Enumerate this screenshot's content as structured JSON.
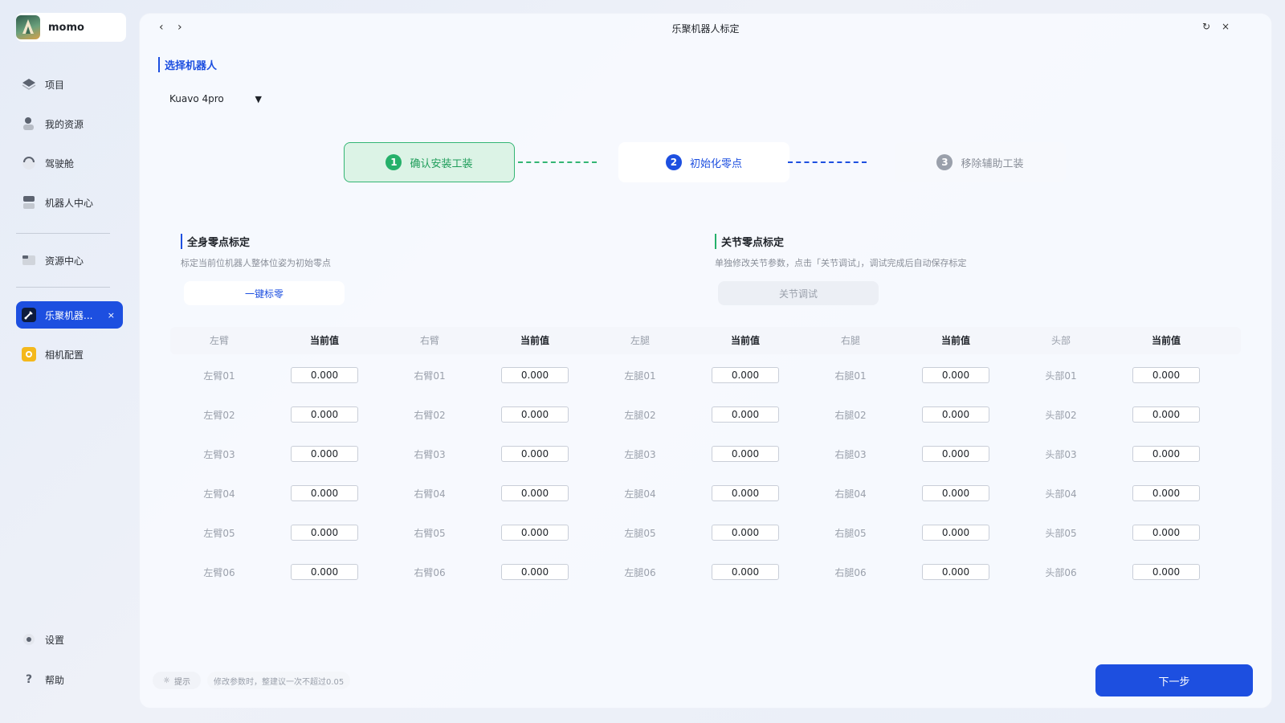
{
  "app": {
    "name": "momo"
  },
  "sidebar": {
    "items": [
      {
        "label": "项目",
        "icon": "layers-icon"
      },
      {
        "label": "我的资源",
        "icon": "user-resource-icon"
      },
      {
        "label": "驾驶舱",
        "icon": "cockpit-icon"
      },
      {
        "label": "机器人中心",
        "icon": "robot-center-icon"
      },
      {
        "label": "资源中心",
        "icon": "folder-icon"
      },
      {
        "label": "乐聚机器...",
        "icon": "robot-tool-icon",
        "active": true,
        "close": "×"
      },
      {
        "label": "相机配置",
        "icon": "camera-icon"
      }
    ],
    "bottom": [
      {
        "label": "设置",
        "icon": "settings-dot-icon"
      },
      {
        "label": "帮助",
        "icon": "help-icon",
        "glyph": "?"
      }
    ]
  },
  "window": {
    "title": "乐聚机器人标定",
    "back": "‹",
    "forward": "›",
    "refresh": "↻",
    "close": "×"
  },
  "robot_select": {
    "title": "选择机器人",
    "value": "Kuavo 4pro",
    "caret": "▼"
  },
  "steps": [
    {
      "num": "1",
      "label": "确认安装工装",
      "state": "done"
    },
    {
      "num": "2",
      "label": "初始化零点",
      "state": "current"
    },
    {
      "num": "3",
      "label": "移除辅助工装",
      "state": "pending"
    }
  ],
  "whole_body": {
    "title": "全身零点标定",
    "desc": "标定当前位机器人整体位姿为初始零点",
    "button": "一键标零"
  },
  "joint": {
    "title": "关节零点标定",
    "desc": "单独修改关节参数，点击「关节调试」，调试完成后自动保存标定",
    "button": "关节调试"
  },
  "table": {
    "headers": [
      "左臂",
      "当前值",
      "右臂",
      "当前值",
      "左腿",
      "当前值",
      "右腿",
      "当前值",
      "头部",
      "当前值"
    ],
    "rows": [
      [
        "左臂01",
        "0.000",
        "右臂01",
        "0.000",
        "左腿01",
        "0.000",
        "右腿01",
        "0.000",
        "头部01",
        "0.000"
      ],
      [
        "左臂02",
        "0.000",
        "右臂02",
        "0.000",
        "左腿02",
        "0.000",
        "右腿02",
        "0.000",
        "头部02",
        "0.000"
      ],
      [
        "左臂03",
        "0.000",
        "右臂03",
        "0.000",
        "左腿03",
        "0.000",
        "右腿03",
        "0.000",
        "头部03",
        "0.000"
      ],
      [
        "左臂04",
        "0.000",
        "右臂04",
        "0.000",
        "左腿04",
        "0.000",
        "右腿04",
        "0.000",
        "头部04",
        "0.000"
      ],
      [
        "左臂05",
        "0.000",
        "右臂05",
        "0.000",
        "左腿05",
        "0.000",
        "右腿05",
        "0.000",
        "头部05",
        "0.000"
      ],
      [
        "左臂06",
        "0.000",
        "右臂06",
        "0.000",
        "左腿06",
        "0.000",
        "右腿06",
        "0.000",
        "头部06",
        "0.000"
      ]
    ]
  },
  "footer": {
    "hint_label": "提示",
    "hint_text": "修改参数时，整建议一次不超过0.05",
    "next": "下一步"
  },
  "colors": {
    "accent": "#1d4fe0",
    "success": "#25b06a"
  }
}
